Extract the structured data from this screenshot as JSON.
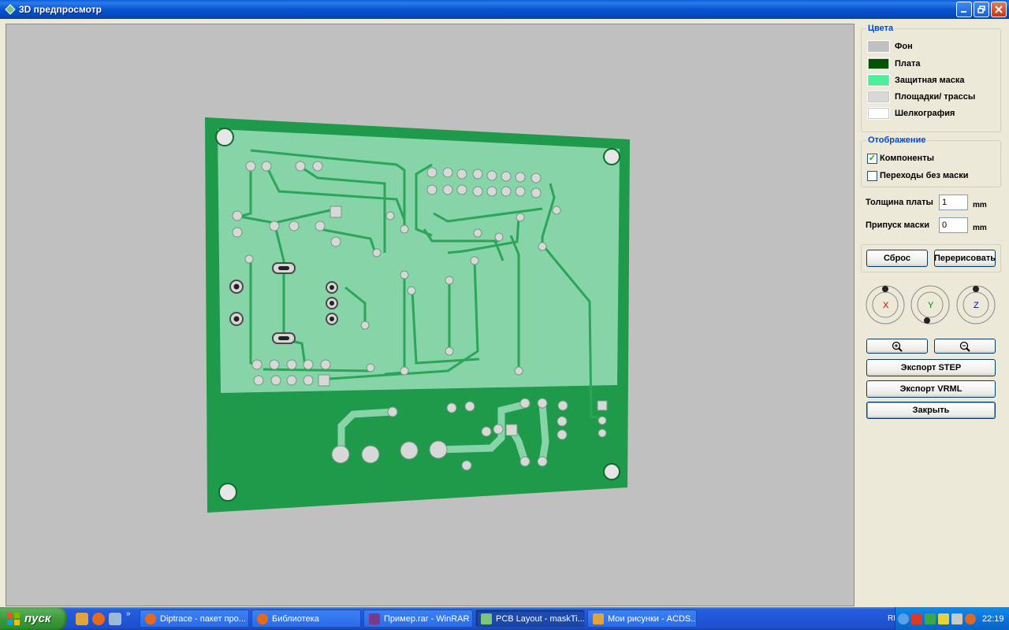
{
  "window": {
    "title": "3D предпросмотр"
  },
  "colors_group": {
    "title": "Цвета",
    "items": [
      {
        "label": "Фон",
        "color": "#C0C0C0"
      },
      {
        "label": "Плата",
        "color": "#005400"
      },
      {
        "label": "Защитная маска",
        "color": "#4CF09A"
      },
      {
        "label": "Площадки/ трассы",
        "color": "#D8D8D8"
      },
      {
        "label": "Шелкография",
        "color": "#FFFFFF"
      }
    ]
  },
  "display_group": {
    "title": "Отображение",
    "components_label": "Компоненты",
    "components_checked": true,
    "vias_label": "Переходы без маски",
    "vias_checked": false
  },
  "board_thickness": {
    "label": "Толщина платы",
    "value": "1",
    "unit": "mm"
  },
  "mask_clearance": {
    "label": "Припуск маски",
    "value": "0",
    "unit": "mm"
  },
  "buttons": {
    "reset": "Сброс",
    "redraw": "Перерисовать",
    "export_step": "Экспорт STEP",
    "export_vrml": "Экспорт VRML",
    "close": "Закрыть"
  },
  "axes": [
    "X",
    "Y",
    "Z"
  ],
  "taskbar": {
    "start_label": "пуск",
    "tasks": [
      "Diptrace - пакет про...",
      "Библиотека",
      "Пример.rar - WinRAR",
      "PCB Layout - maskTi...",
      "Мои рисунки - ACDS..."
    ],
    "active_task_index": 3,
    "lang": "RL",
    "clock": "22:19"
  }
}
